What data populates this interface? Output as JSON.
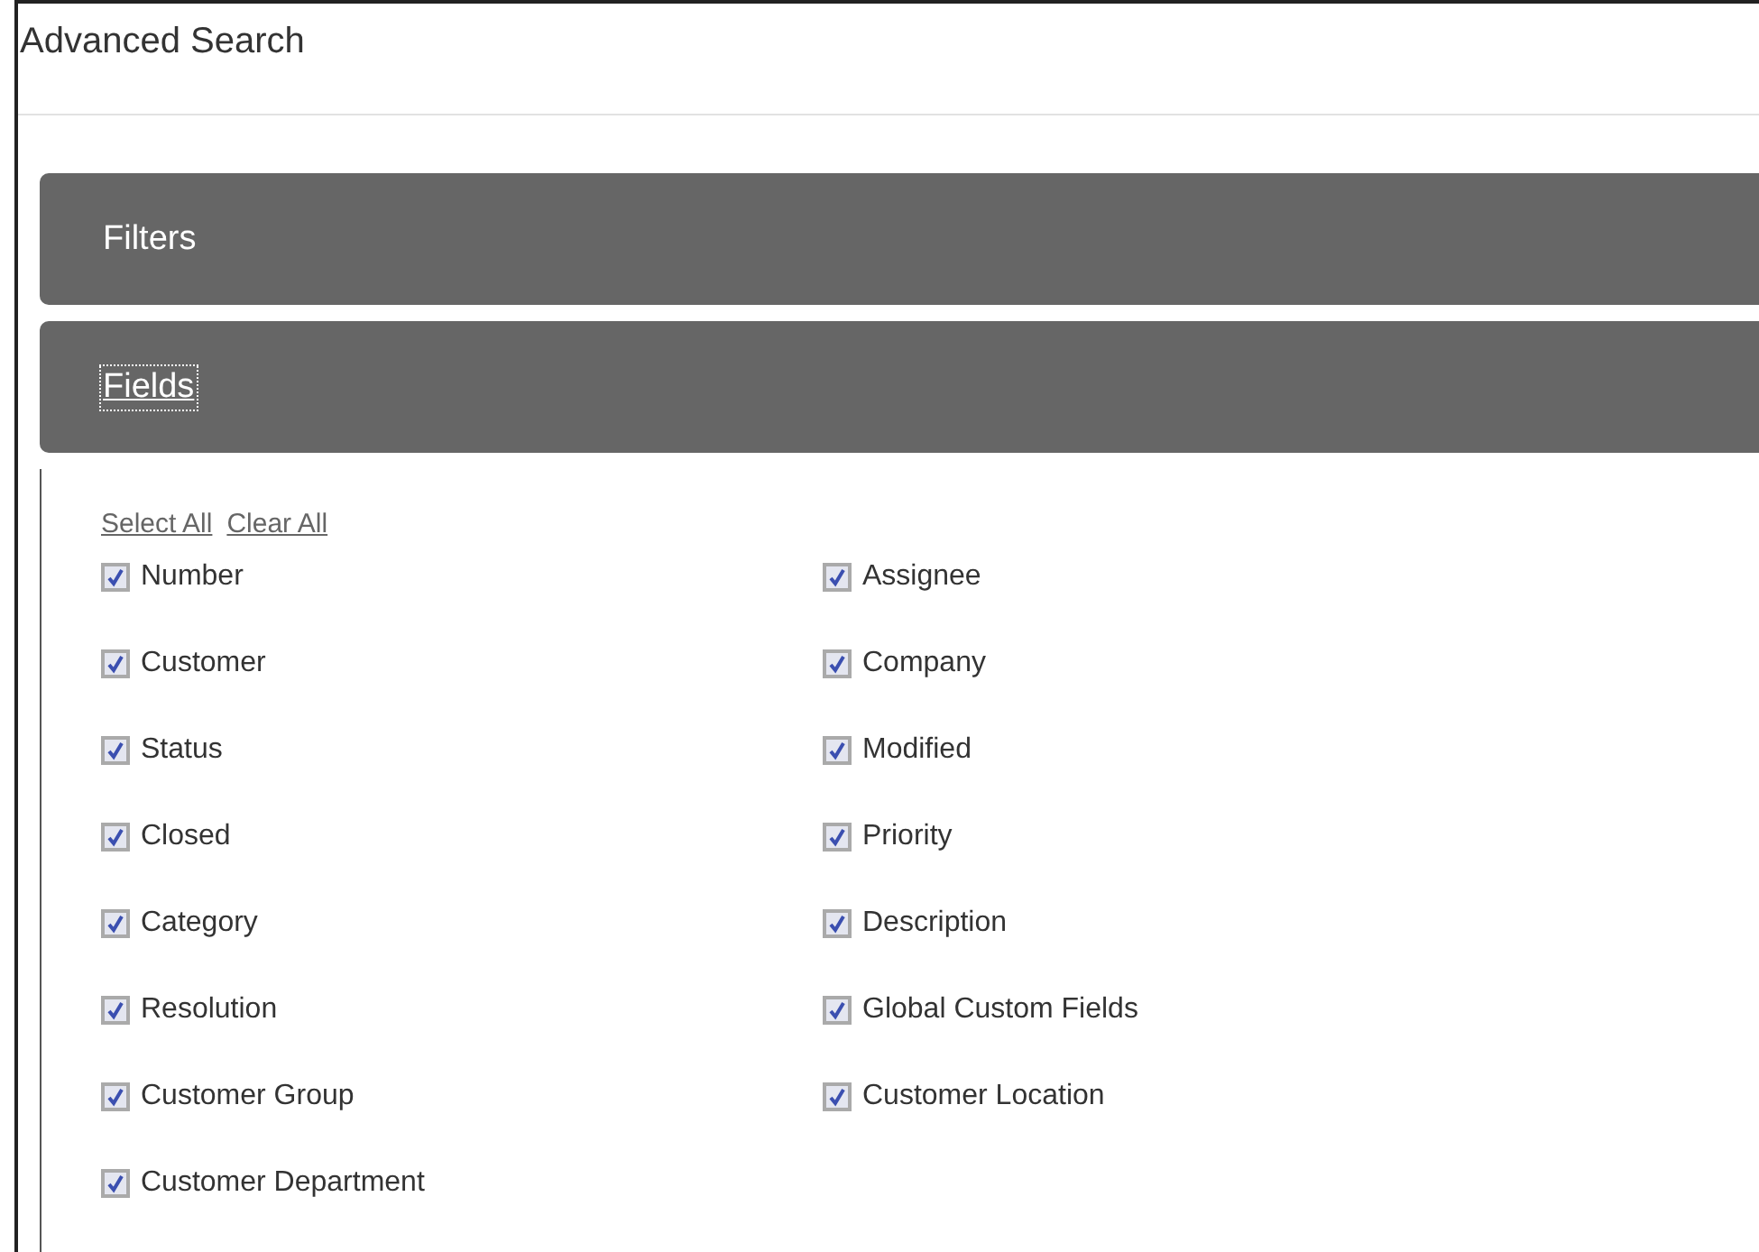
{
  "window": {
    "title": "Advanced Search"
  },
  "sections": [
    {
      "title": "Filters",
      "focused": false
    },
    {
      "title": "Fields",
      "focused": true
    }
  ],
  "links": [
    "Select All",
    "Clear All"
  ],
  "fields": [
    {
      "label": "Number",
      "checked": true
    },
    {
      "label": "Assignee",
      "checked": true
    },
    {
      "label": "Customer",
      "checked": true
    },
    {
      "label": "Company",
      "checked": true
    },
    {
      "label": "Status",
      "checked": true
    },
    {
      "label": "Modified",
      "checked": true
    },
    {
      "label": "Closed",
      "checked": true
    },
    {
      "label": "Priority",
      "checked": true
    },
    {
      "label": "Category",
      "checked": true
    },
    {
      "label": "Description",
      "checked": true
    },
    {
      "label": "Resolution",
      "checked": true
    },
    {
      "label": "Global Custom Fields",
      "checked": true
    },
    {
      "label": "Customer Group",
      "checked": true
    },
    {
      "label": "Customer Location",
      "checked": true
    },
    {
      "label": "Customer Department",
      "checked": true
    }
  ]
}
